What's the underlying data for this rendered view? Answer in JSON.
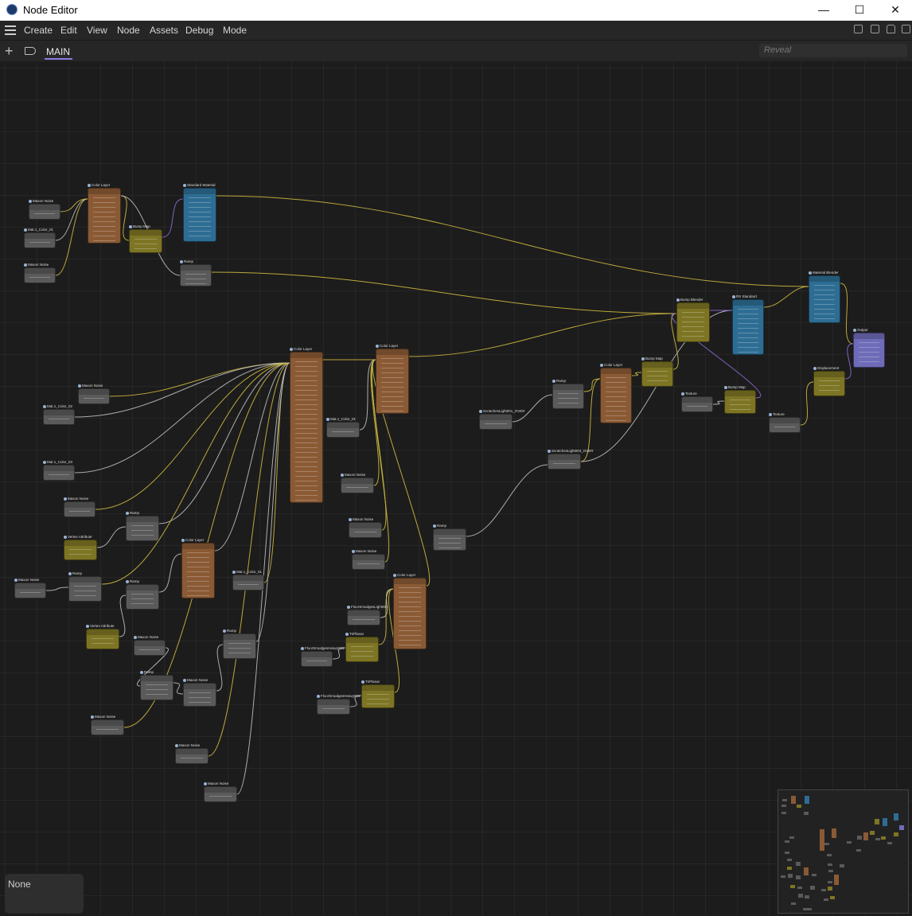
{
  "window": {
    "title": "Node Editor",
    "minimize": "—",
    "maximize": "☐",
    "close": "✕"
  },
  "menu": [
    "Create",
    "Edit",
    "View",
    "Node",
    "Assets",
    "Debug",
    "Mode"
  ],
  "tab": {
    "label": "MAIN"
  },
  "search": {
    "placeholder": "Reveal"
  },
  "status": {
    "selection": "None"
  },
  "colors": {
    "texture": "#5a5a5a",
    "layer": "#8a5a35",
    "bump": "#7d7524",
    "material": "#2e6d93",
    "output": "#6e6bb8",
    "wire_yellow": "#cdb83f",
    "wire_white": "#bdbdbd",
    "wire_purple": "#8c6ad6"
  },
  "nodes": [
    {
      "title": "Maxon Noise",
      "kind": "texture"
    },
    {
      "title": "Mat.1_Color_01",
      "kind": "texture"
    },
    {
      "title": "Maxon Noise",
      "kind": "texture"
    },
    {
      "title": "Color Layer",
      "kind": "layer"
    },
    {
      "title": "Bump Map",
      "kind": "bump"
    },
    {
      "title": "Standard Material",
      "kind": "material"
    },
    {
      "title": "Ramp",
      "kind": "texture"
    },
    {
      "title": "Color Layer",
      "kind": "layer"
    },
    {
      "title": "Color Layer",
      "kind": "layer"
    },
    {
      "title": "Maxon Noise",
      "kind": "texture"
    },
    {
      "title": "Mat.1_Color_02",
      "kind": "texture"
    },
    {
      "title": "Mat.1_Color_01",
      "kind": "texture"
    },
    {
      "title": "Mat.1_Color_03",
      "kind": "texture"
    },
    {
      "title": "Maxon Noise",
      "kind": "texture"
    },
    {
      "title": "Ramp",
      "kind": "texture"
    },
    {
      "title": "Vertex Attribute",
      "kind": "bump"
    },
    {
      "title": "Color Layer",
      "kind": "layer"
    },
    {
      "title": "Maxon Noise",
      "kind": "texture"
    },
    {
      "title": "Ramp",
      "kind": "texture"
    },
    {
      "title": "Ramp",
      "kind": "texture"
    },
    {
      "title": "Mat.1_Color_01",
      "kind": "texture"
    },
    {
      "title": "Vertex Attribute",
      "kind": "bump"
    },
    {
      "title": "Maxon Noise",
      "kind": "texture"
    },
    {
      "title": "Ramp",
      "kind": "texture"
    },
    {
      "title": "Maxon Noise",
      "kind": "texture"
    },
    {
      "title": "Ramp",
      "kind": "texture"
    },
    {
      "title": "Maxon Noise",
      "kind": "texture"
    },
    {
      "title": "Maxon Noise",
      "kind": "texture"
    },
    {
      "title": "Maxon Noise",
      "kind": "texture"
    },
    {
      "title": "Maxon Noise",
      "kind": "texture"
    },
    {
      "title": "Maxon Noise",
      "kind": "texture"
    },
    {
      "title": "Maxon Noise",
      "kind": "texture"
    },
    {
      "title": "Ramp",
      "kind": "texture"
    },
    {
      "title": "Color Layer",
      "kind": "layer"
    },
    {
      "title": "FloorSmudgesLight001",
      "kind": "texture"
    },
    {
      "title": "FloorSmudgesHeavy001",
      "kind": "texture"
    },
    {
      "title": "TriPlanar",
      "kind": "bump"
    },
    {
      "title": "FloorSmudgesHeavy001",
      "kind": "texture"
    },
    {
      "title": "TriPlanar",
      "kind": "bump"
    },
    {
      "title": "ScratchesLight001_OVER",
      "kind": "texture"
    },
    {
      "title": "Ramp",
      "kind": "texture"
    },
    {
      "title": "ScratchesLight004_OVER",
      "kind": "texture"
    },
    {
      "title": "Color Layer",
      "kind": "layer"
    },
    {
      "title": "Bump Map",
      "kind": "bump"
    },
    {
      "title": "Bump Blender",
      "kind": "bump"
    },
    {
      "title": "RS Standard",
      "kind": "material"
    },
    {
      "title": "Texture",
      "kind": "texture"
    },
    {
      "title": "Bump Map",
      "kind": "bump"
    },
    {
      "title": "Material Blender",
      "kind": "material"
    },
    {
      "title": "Output",
      "kind": "output"
    },
    {
      "title": "Displacement",
      "kind": "bump"
    },
    {
      "title": "Texture",
      "kind": "texture"
    }
  ]
}
